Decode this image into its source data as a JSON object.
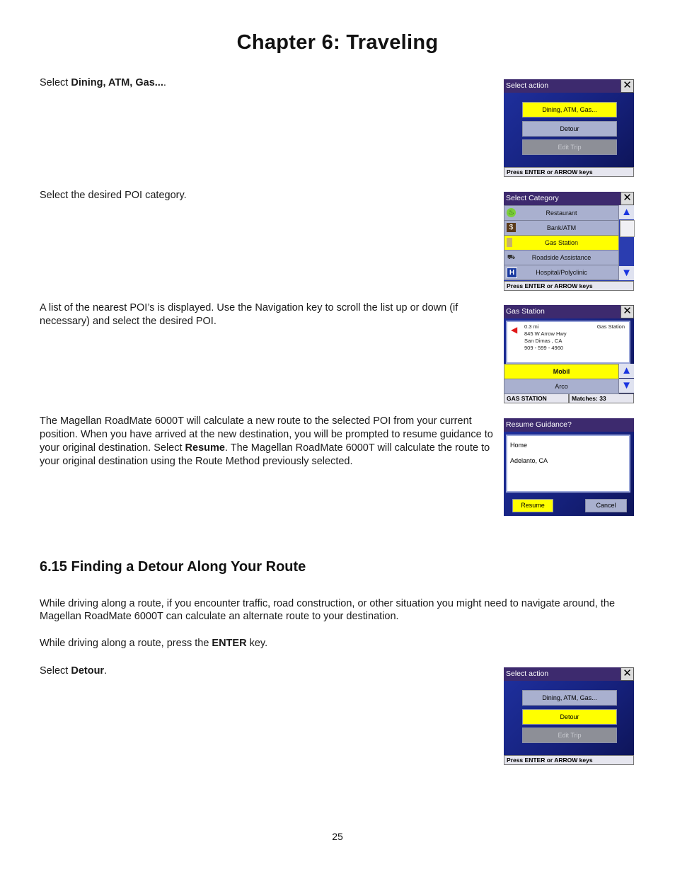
{
  "page": {
    "chapter_title": "Chapter 6: Traveling",
    "page_number": "25"
  },
  "steps": {
    "s1": {
      "prefix": "Select ",
      "bold": "Dining, ATM, Gas...",
      "suffix": "."
    },
    "s2": {
      "text": "Select the desired POI category."
    },
    "s3": {
      "text": "A list of the nearest POI’s is displayed. Use the Navigation key to scroll the list up or down (if necessary) and select the desired POI."
    },
    "s4": {
      "part1": "The Magellan RoadMate 6000T will calculate a new route to the selected POI from your current position. When you have arrived at the new destination, you will be prompted to resume guidance to your original destination. Select ",
      "bold": "Resume",
      "part2": ". The Magellan RoadMate 6000T will calculate the route to your original destination using the Route Method previously selected."
    }
  },
  "section": {
    "heading": "6.15 Finding a Detour Along Your Route",
    "p1": "While driving along a route, if you encounter traffic, road construction, or other situation you might need to navigate around, the Magellan RoadMate 6000T can calculate an alternate route to your destination.",
    "p2": {
      "prefix": "While driving along a route, press the ",
      "bold": "ENTER",
      "suffix": " key."
    },
    "p3": {
      "prefix": "Select ",
      "bold": "Detour",
      "suffix": "."
    }
  },
  "screens": {
    "select_action_1": {
      "title": "Select action",
      "close_icon": "close-x-icon",
      "buttons": [
        {
          "label": "Dining, ATM, Gas...",
          "state": "selected"
        },
        {
          "label": "Detour",
          "state": "normal"
        },
        {
          "label": "Edit Trip",
          "state": "disabled"
        }
      ],
      "status": "Press ENTER or ARROW keys"
    },
    "select_category": {
      "title": "Select Category",
      "close_icon": "close-x-icon",
      "items": [
        {
          "label": "Restaurant",
          "icon": "restaurant-icon",
          "state": "normal"
        },
        {
          "label": "Bank/ATM",
          "icon": "bank-icon",
          "state": "normal"
        },
        {
          "label": "Gas Station",
          "icon": "gas-pump-icon",
          "state": "selected"
        },
        {
          "label": "Roadside Assistance",
          "icon": "tow-truck-icon",
          "state": "normal"
        },
        {
          "label": "Hospital/Polyclinic",
          "icon": "hospital-icon",
          "state": "normal"
        }
      ],
      "scroll_up": "▲",
      "scroll_down": "▼",
      "status": "Press ENTER or ARROW keys"
    },
    "gas_station": {
      "title": "Gas Station",
      "close_icon": "close-x-icon",
      "info": {
        "distance": "0.3 mi",
        "category": "Gas Station",
        "address": "845 W Arrow Hwy",
        "city": "San Dimas , CA",
        "phone": "909 - 599 - 4960",
        "direction_icon": "direction-arrow-icon"
      },
      "results": [
        {
          "label": "Mobil",
          "state": "selected"
        },
        {
          "label": "Arco",
          "state": "normal"
        }
      ],
      "scroll_up": "▲",
      "scroll_down": "▼",
      "status_left": "GAS STATION",
      "status_right": "Matches: 33"
    },
    "resume_guidance": {
      "title": "Resume Guidance?",
      "line1": "Home",
      "line2": "Adelanto, CA",
      "resume_label": "Resume",
      "cancel_label": "Cancel"
    },
    "select_action_2": {
      "title": "Select action",
      "close_icon": "close-x-icon",
      "buttons": [
        {
          "label": "Dining, ATM, Gas...",
          "state": "normal"
        },
        {
          "label": "Detour",
          "state": "selected"
        },
        {
          "label": "Edit Trip",
          "state": "disabled"
        }
      ],
      "status": "Press ENTER or ARROW keys"
    }
  },
  "colors": {
    "title_bar": "#3d2a6e",
    "screen_blue": "#1e2f9c",
    "highlight_yellow": "#ffff00",
    "button_gray_blue": "#a9b0cf",
    "disabled_gray": "#8d8f97"
  }
}
